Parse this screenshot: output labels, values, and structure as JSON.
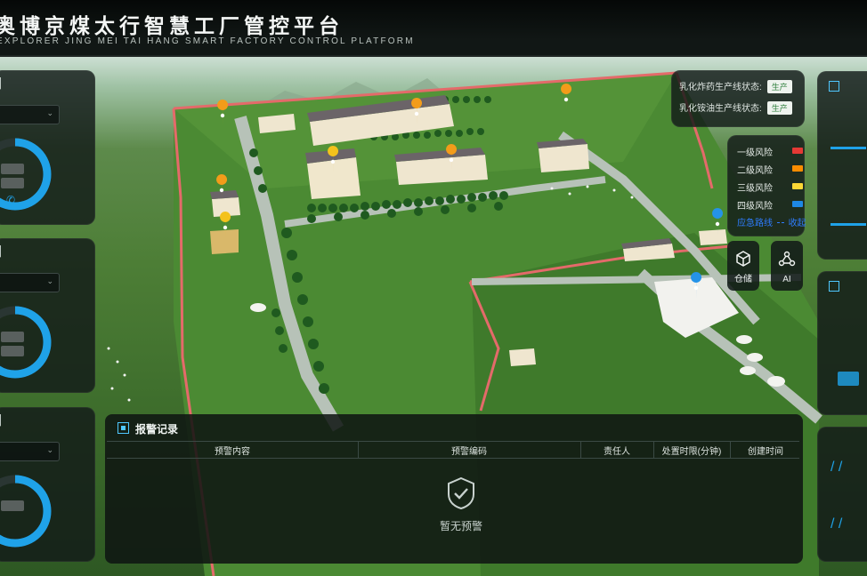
{
  "header": {
    "title": "奥博京煤太行智慧工厂管控平台",
    "subtitle": "EXPLORER JING MEI TAI HANG SMART FACTORY CONTROL PLATFORM"
  },
  "status": [
    {
      "label": "乳化炸药生产线状态:",
      "value": "生产"
    },
    {
      "label": "乳化铵油生产线状态:",
      "value": "生产"
    }
  ],
  "risk_legend": {
    "items": [
      {
        "label": "一级风险",
        "color": "#e53935"
      },
      {
        "label": "二级风险",
        "color": "#fb8c00"
      },
      {
        "label": "三级风险",
        "color": "#fdd835"
      },
      {
        "label": "四级风险",
        "color": "#1e88e5"
      }
    ],
    "route_label": "应急路线",
    "route_toggle": "收起",
    "route_color": "#2e7dff"
  },
  "tools": [
    {
      "label": "仓储",
      "icon": "warehouse-cube-icon"
    },
    {
      "label": "AI",
      "icon": "ai-network-icon"
    }
  ],
  "alarm": {
    "title": "报警记录",
    "columns": [
      "预警内容",
      "预警编码",
      "责任人",
      "处置时限(分钟)",
      "创建时间"
    ],
    "empty_text": "暂无预警"
  },
  "colors": {
    "accent": "#1fa2e8",
    "panel_bg": "#121a18",
    "badge_text": "#2a7c38",
    "fence": "#e46a6a"
  }
}
